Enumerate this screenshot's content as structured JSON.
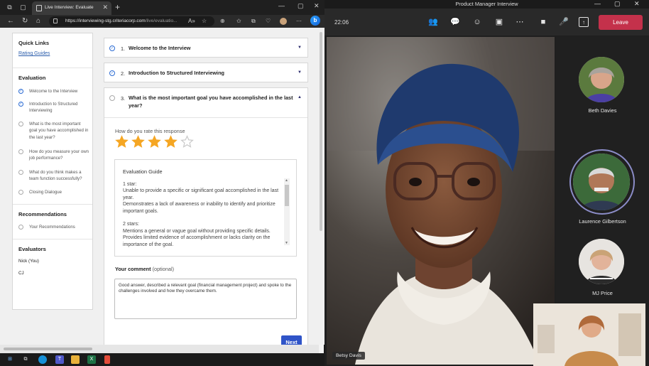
{
  "browser": {
    "tab_title": "Live Interview: Evaluate",
    "url_host": "https://interviewing-stg.criteriacorp.com",
    "url_path": "/live/evaluatio...",
    "new_tab_label": "+"
  },
  "sidebar": {
    "quick_links_heading": "Quick Links",
    "rating_guides_link": "Rating Guides",
    "evaluation_heading": "Evaluation",
    "evaluation_items": [
      {
        "label": "Welcome to the Interview",
        "done": true
      },
      {
        "label": "Introduction to Structured Interviewing",
        "done": true
      },
      {
        "label": "What is the most important goal you have accomplished in the last year?",
        "done": false
      },
      {
        "label": "How do you measure your own job performance?",
        "done": false
      },
      {
        "label": "What do you think makes a team function successfully?",
        "done": false
      },
      {
        "label": "Closing Dialogue",
        "done": false
      }
    ],
    "recommendations_heading": "Recommendations",
    "recommendations_item": "Your Recommendations",
    "evaluators_heading": "Evaluators",
    "evaluators": [
      "Nick (You)",
      "CJ"
    ]
  },
  "questions": [
    {
      "number": "1.",
      "title": "Welcome to the Interview",
      "done": true
    },
    {
      "number": "2.",
      "title": "Introduction to Structured Interviewing",
      "done": true
    },
    {
      "number": "3.",
      "title": "What is the most important goal you have accomplished in the last year?",
      "done": false
    }
  ],
  "rating": {
    "label": "How do you rate this response",
    "value": 4,
    "max": 5,
    "filled_color": "#f5a623",
    "empty_color": "#c9c9c9"
  },
  "guide": {
    "heading": "Evaluation Guide",
    "paragraphs": [
      "1 star:\nUnable to provide a specific or significant goal accomplished in the last year.\nDemonstrates a lack of awareness or inability to identify and prioritize important goals.",
      "2 stars:\nMentions a general or vague goal without providing specific details.\nProvides limited evidence of accomplishment or lacks clarity on the importance of the goal."
    ]
  },
  "comment": {
    "label": "Your comment",
    "optional": "(optional)",
    "value": "Good answer, described a relevant goal (financial management project) and spoke to the challenges involved and how they overcame them."
  },
  "next_button": "Next",
  "teams": {
    "window_title": "Product Manager Interview",
    "time": "22:06",
    "leave_label": "Leave",
    "main_speaker": "Betsy Davis",
    "participants": [
      {
        "name": "Beth Davies",
        "speaking": false
      },
      {
        "name": "Laurence Gilbertson",
        "speaking": true
      },
      {
        "name": "MJ Price",
        "speaking": false
      }
    ],
    "accent": "#c4314b"
  }
}
